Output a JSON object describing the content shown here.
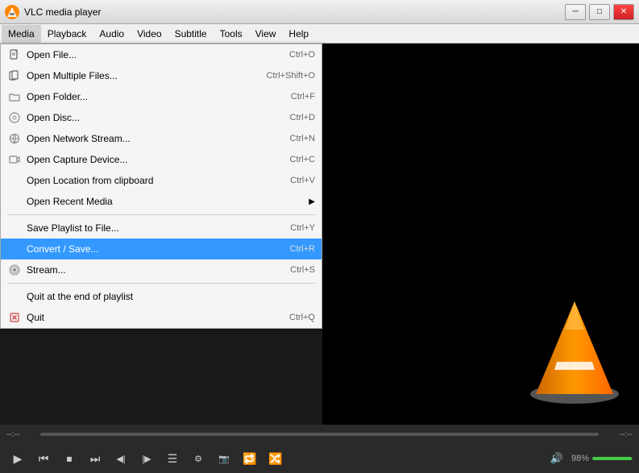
{
  "titlebar": {
    "icon": "vlc",
    "title": "VLC media player",
    "controls": {
      "minimize": "─",
      "maximize": "□",
      "close": "✕"
    }
  },
  "menubar": {
    "items": [
      {
        "id": "media",
        "label": "Media",
        "active": true
      },
      {
        "id": "playback",
        "label": "Playback",
        "active": false
      },
      {
        "id": "audio",
        "label": "Audio",
        "active": false
      },
      {
        "id": "video",
        "label": "Video",
        "active": false
      },
      {
        "id": "subtitle",
        "label": "Subtitle",
        "active": false
      },
      {
        "id": "tools",
        "label": "Tools",
        "active": false
      },
      {
        "id": "view",
        "label": "View",
        "active": false
      },
      {
        "id": "help",
        "label": "Help",
        "active": false
      }
    ]
  },
  "dropdown": {
    "items": [
      {
        "id": "open-file",
        "label": "Open File...",
        "shortcut": "Ctrl+O",
        "icon": "file",
        "separator_after": false
      },
      {
        "id": "open-multiple",
        "label": "Open Multiple Files...",
        "shortcut": "Ctrl+Shift+O",
        "icon": "files",
        "separator_after": false
      },
      {
        "id": "open-folder",
        "label": "Open Folder...",
        "shortcut": "Ctrl+F",
        "icon": "folder",
        "separator_after": false
      },
      {
        "id": "open-disc",
        "label": "Open Disc...",
        "shortcut": "Ctrl+D",
        "icon": "disc",
        "separator_after": false
      },
      {
        "id": "open-network",
        "label": "Open Network Stream...",
        "shortcut": "Ctrl+N",
        "icon": "network",
        "separator_after": false
      },
      {
        "id": "open-capture",
        "label": "Open Capture Device...",
        "shortcut": "Ctrl+C",
        "icon": "capture",
        "separator_after": false
      },
      {
        "id": "open-location",
        "label": "Open Location from clipboard",
        "shortcut": "Ctrl+V",
        "icon": null,
        "separator_after": false
      },
      {
        "id": "open-recent",
        "label": "Open Recent Media",
        "shortcut": "",
        "icon": null,
        "arrow": true,
        "separator_after": true
      },
      {
        "id": "save-playlist",
        "label": "Save Playlist to File...",
        "shortcut": "Ctrl+Y",
        "icon": null,
        "separator_after": false
      },
      {
        "id": "convert-save",
        "label": "Convert / Save...",
        "shortcut": "Ctrl+R",
        "icon": null,
        "separator_after": false,
        "highlighted": true
      },
      {
        "id": "stream",
        "label": "Stream...",
        "shortcut": "Ctrl+S",
        "icon": "stream",
        "separator_after": false
      },
      {
        "id": "quit-playlist",
        "label": "Quit at the end of playlist",
        "shortcut": "",
        "icon": null,
        "separator_after": false
      },
      {
        "id": "quit",
        "label": "Quit",
        "shortcut": "Ctrl+Q",
        "icon": "quit",
        "separator_after": false
      }
    ]
  },
  "seekbar": {
    "left_label": "--:--",
    "right_label": "--:--"
  },
  "controls": {
    "play_label": "▶",
    "prev_label": "⏮",
    "stop_label": "⏹",
    "next_label": "⏭",
    "frame_back": "⏴",
    "frame_fwd": "⏵",
    "playlist": "☰",
    "extended": "🎚",
    "snapshot": "📷",
    "loop": "🔁",
    "random": "🔀",
    "volume_label": "98%",
    "volume_pct": 98
  }
}
